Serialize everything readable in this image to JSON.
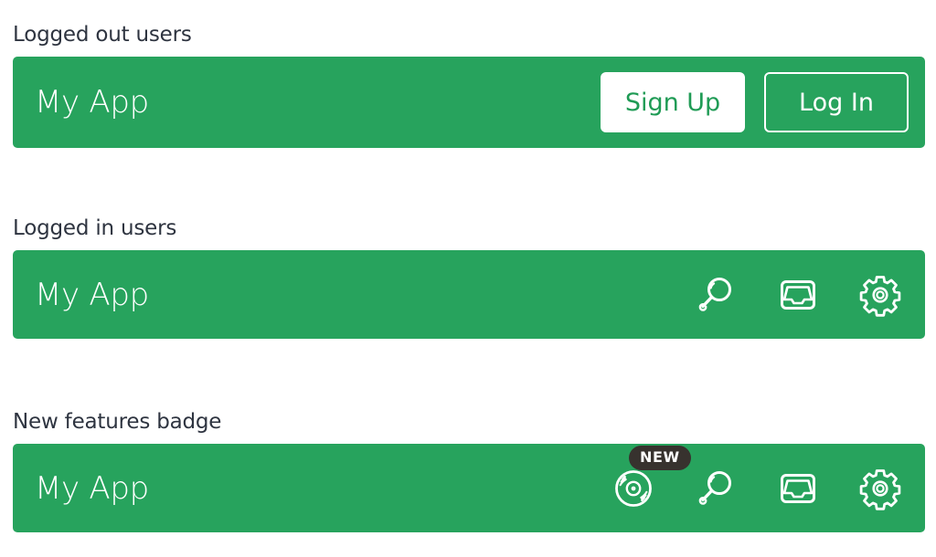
{
  "theme": {
    "brand_green": "#27a35d",
    "badge_dark": "#37322e",
    "heading_color": "#2e3440",
    "on_brand": "#ffffff",
    "page_background": "#ffffff"
  },
  "sections": [
    {
      "title": "Logged out users",
      "appbar": {
        "brand": "My App",
        "buttons": [
          {
            "label": "Sign Up",
            "style": "filled"
          },
          {
            "label": "Log In",
            "style": "outlined"
          }
        ]
      }
    },
    {
      "title": "Logged in users",
      "appbar": {
        "brand": "My App",
        "icons": [
          {
            "name": "search-icon",
            "label": "Search"
          },
          {
            "name": "inbox-icon",
            "label": "Inbox"
          },
          {
            "name": "settings-gear-icon",
            "label": "Settings"
          }
        ]
      }
    },
    {
      "title": "New features badge",
      "appbar": {
        "brand": "My App",
        "badge": "NEW",
        "icons": [
          {
            "name": "disc-record-icon",
            "label": "Music"
          },
          {
            "name": "search-icon",
            "label": "Search"
          },
          {
            "name": "inbox-icon",
            "label": "Inbox"
          },
          {
            "name": "settings-gear-icon",
            "label": "Settings"
          }
        ]
      }
    }
  ]
}
